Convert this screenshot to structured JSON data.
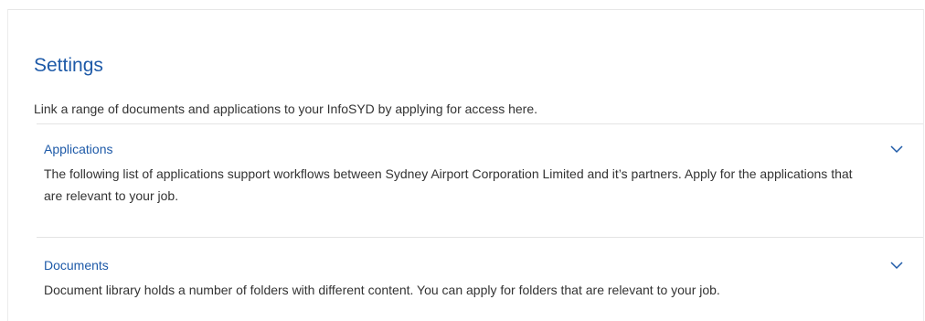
{
  "settings": {
    "title": "Settings",
    "description": "Link a range of documents and applications to your InfoSYD by applying for access here."
  },
  "sections": [
    {
      "title": "Applications",
      "text": "The following list of applications support workflows between Sydney Airport Corporation Limited and it’s partners. Apply for the applications that are relevant to your job.",
      "expand_icon": "chevron-down-icon"
    },
    {
      "title": "Documents",
      "text": "Document library holds a number of folders with different content. You can apply for folders that are relevant to your job.",
      "expand_icon": "chevron-down-icon"
    }
  ],
  "colors": {
    "accent": "#1e5aa8",
    "text": "#333333",
    "divider": "#e4e4e4"
  }
}
